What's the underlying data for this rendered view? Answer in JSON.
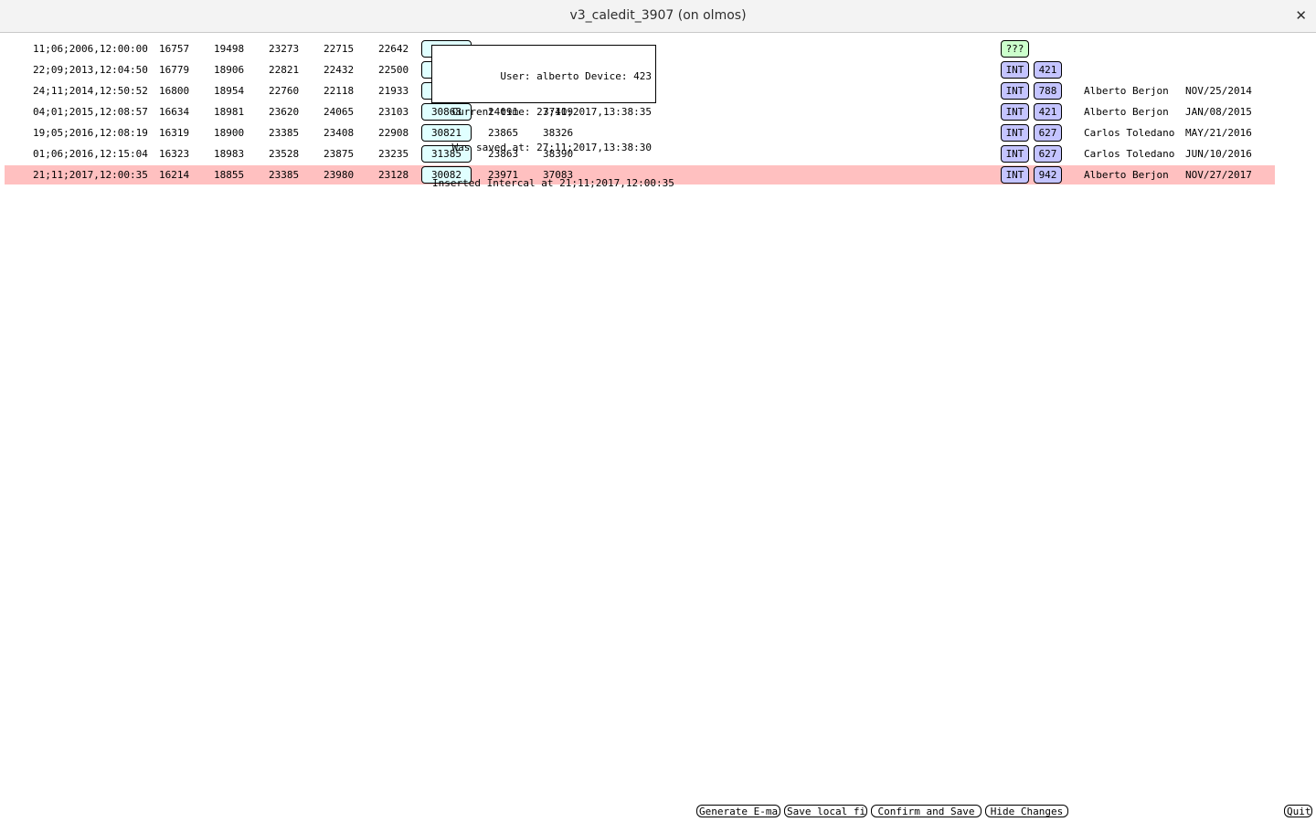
{
  "window": {
    "title": "v3_caledit_3907 (on olmos)",
    "close_glyph": "✕"
  },
  "rows": [
    {
      "date": "11;06;2006,12:00:00",
      "c1": "16757",
      "c2": "19498",
      "c3": "23273",
      "c4": "22715",
      "c5": "22642",
      "box": "",
      "c6": "",
      "c7": "",
      "type": "???",
      "device": "",
      "user": "",
      "saved": ""
    },
    {
      "date": "22;09;2013,12:04:50",
      "c1": "16779",
      "c2": "18906",
      "c3": "22821",
      "c4": "22432",
      "c5": "22500",
      "box": "",
      "c6": "",
      "c7": "",
      "type": "INT",
      "device": "421",
      "user": "",
      "saved": ""
    },
    {
      "date": "24;11;2014,12:50:52",
      "c1": "16800",
      "c2": "18954",
      "c3": "22760",
      "c4": "22118",
      "c5": "21933",
      "box": "",
      "c6": "",
      "c7": "",
      "type": "INT",
      "device": "788",
      "user": "Alberto Berjon",
      "saved": "NOV/25/2014"
    },
    {
      "date": "04;01;2015,12:08:57",
      "c1": "16634",
      "c2": "18981",
      "c3": "23620",
      "c4": "24065",
      "c5": "23103",
      "box": "30868",
      "c6": "24091",
      "c7": "37409",
      "type": "INT",
      "device": "421",
      "user": "Alberto Berjon",
      "saved": "JAN/08/2015"
    },
    {
      "date": "19;05;2016,12:08:19",
      "c1": "16319",
      "c2": "18900",
      "c3": "23385",
      "c4": "23408",
      "c5": "22908",
      "box": "30821",
      "c6": "23865",
      "c7": "38326",
      "type": "INT",
      "device": "627",
      "user": "Carlos Toledano",
      "saved": "MAY/21/2016"
    },
    {
      "date": "01;06;2016,12:15:04",
      "c1": "16323",
      "c2": "18983",
      "c3": "23528",
      "c4": "23875",
      "c5": "23235",
      "box": "31385",
      "c6": "23863",
      "c7": "38390",
      "type": "INT",
      "device": "627",
      "user": "Carlos Toledano",
      "saved": "JUN/10/2016"
    },
    {
      "date": "21;11;2017,12:00:35",
      "c1": "16214",
      "c2": "18855",
      "c3": "23385",
      "c4": "23980",
      "c5": "23128",
      "box": "30082",
      "c6": "23971",
      "c7": "37083",
      "type": "INT",
      "device": "942",
      "user": "Alberto Berjon",
      "saved": "NOV/27/2017"
    }
  ],
  "tooltip": {
    "line1": "User: alberto Device: 423",
    "line2": "Current time: 27;11;2017,13:38:35",
    "line3": "Was saved at: 27;11;2017,13:38:30",
    "line4": "Inserted Intercal at 21;11;2017,12:00:35"
  },
  "buttons": {
    "email": "Generate E-mail",
    "save_local": "Save local file",
    "confirm": "Confirm and Save",
    "hide": "Hide Changes",
    "quit": "Quit"
  },
  "colors": {
    "highlight_row": "#ffc0c0",
    "value_box": "#e0ffff",
    "int_badge": "#c4c4ff",
    "unknown_badge": "#ccffcc"
  }
}
